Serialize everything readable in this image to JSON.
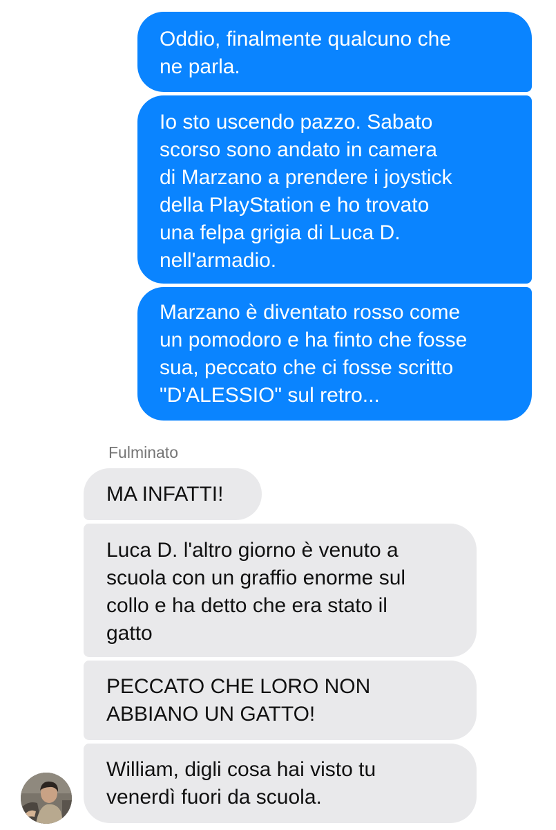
{
  "conversation": {
    "outgoing": [
      {
        "text": "Oddio, finalmente qualcuno che\nne parla."
      },
      {
        "text": "Io sto uscendo pazzo. Sabato\nscorso sono andato in camera\ndi Marzano a prendere i joystick\ndella PlayStation e ho trovato\nuna felpa grigia di Luca D.\nnell'armadio."
      },
      {
        "text": "Marzano è diventato rosso come\nun pomodoro e ha finto che fosse\nsua, peccato che ci fosse scritto\n\"D'ALESSIO\" sul retro..."
      }
    ],
    "incoming_sender": "Fulminato",
    "incoming": [
      {
        "text": "MA INFATTI!"
      },
      {
        "text": "Luca D. l'altro giorno è venuto a\nscuola con un graffio enorme sul\ncollo e ha detto che era stato il\ngatto"
      },
      {
        "text": "PECCATO CHE LORO NON\nABBIANO UN GATTO!"
      },
      {
        "text": "William, digli cosa hai visto tu\nvenerdì fuori da scuola."
      }
    ]
  },
  "colors": {
    "outgoing_bubble": "#0a84ff",
    "incoming_bubble": "#e9e9eb",
    "sender_name": "#757575",
    "background": "#ffffff"
  },
  "icons": {
    "avatar": "user-avatar-photo"
  }
}
